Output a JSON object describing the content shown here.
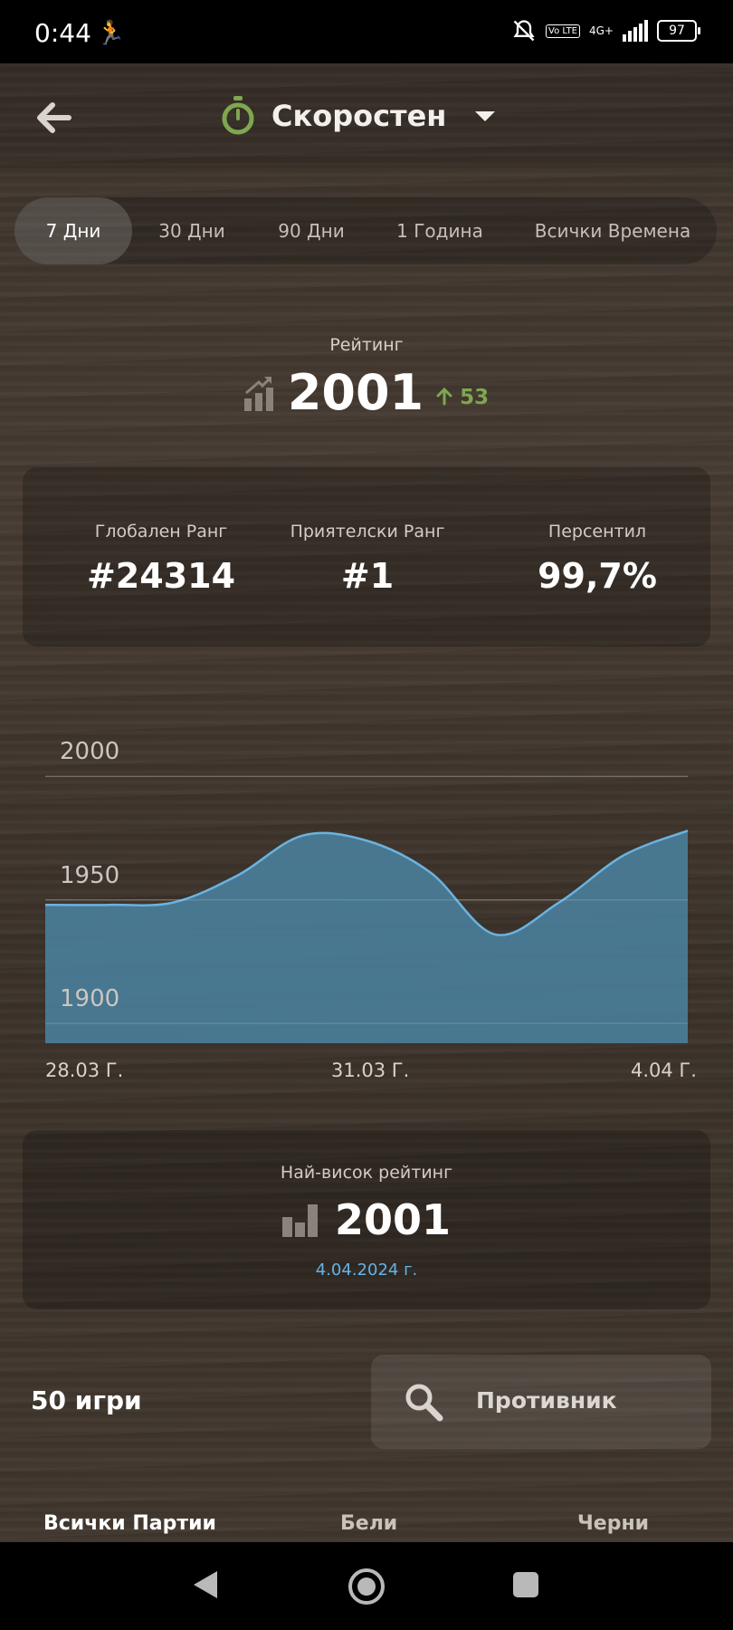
{
  "status_bar": {
    "time": "0:44",
    "volte_badge": "Vo LTE",
    "network": "4G+",
    "battery": "97"
  },
  "header": {
    "title": "Скоростен"
  },
  "tabs": [
    {
      "label": "7 Дни",
      "active": true
    },
    {
      "label": "30 Дни",
      "active": false
    },
    {
      "label": "90 Дни",
      "active": false
    },
    {
      "label": "1 Година",
      "active": false
    },
    {
      "label": "Всички Времена",
      "active": false
    }
  ],
  "rating": {
    "label": "Рейтинг",
    "value": "2001",
    "delta": "53",
    "delta_color": "#7fa650"
  },
  "stats": [
    {
      "label": "Глобален Ранг",
      "value": "#24314"
    },
    {
      "label": "Приятелски Ранг",
      "value": "#1"
    },
    {
      "label": "Персентил",
      "value": "99,7%"
    }
  ],
  "chart_data": {
    "type": "area",
    "title": "",
    "xlabel": "",
    "ylabel": "",
    "y_ticks": [
      "2000",
      "1950",
      "1900"
    ],
    "x_tick_labels": [
      "28.03 Г.",
      "31.03 Г.",
      "4.04 Г."
    ],
    "ylim": [
      1892,
      2032
    ],
    "grid": true,
    "fill_color": "#4a7d99",
    "line_color": "#6ab3e0",
    "series": [
      {
        "x": [
          0,
          0.1,
          0.2,
          0.3,
          0.4,
          0.5,
          0.6,
          0.7,
          0.8,
          0.9,
          1.0
        ],
        "values": [
          1948,
          1948,
          1949,
          1960,
          1976,
          1974,
          1961,
          1936,
          1949,
          1968,
          1978
        ]
      }
    ]
  },
  "best_rating": {
    "label": "Най-висок рейтинг",
    "value": "2001",
    "date": "4.04.2024 г."
  },
  "games": {
    "count_label": "50 игри",
    "opponent_button": "Противник"
  },
  "filters": [
    "Всички Партии",
    "Бели",
    "Черни"
  ]
}
